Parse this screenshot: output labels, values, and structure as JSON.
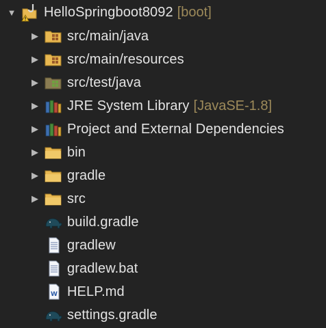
{
  "project": {
    "name": "HelloSpringboot8092",
    "decoration": "[boot]",
    "expanded": true
  },
  "children": [
    {
      "label": "src/main/java",
      "decoration": "",
      "icon": "package-folder-icon",
      "expandable": true
    },
    {
      "label": "src/main/resources",
      "decoration": "",
      "icon": "package-folder-icon",
      "expandable": true
    },
    {
      "label": "src/test/java",
      "decoration": "",
      "icon": "test-package-folder-icon",
      "expandable": true
    },
    {
      "label": "JRE System Library",
      "decoration": "[JavaSE-1.8]",
      "icon": "library-icon",
      "expandable": true
    },
    {
      "label": "Project and External Dependencies",
      "decoration": "",
      "icon": "library-icon",
      "expandable": true
    },
    {
      "label": "bin",
      "decoration": "",
      "icon": "folder-icon",
      "expandable": true
    },
    {
      "label": "gradle",
      "decoration": "",
      "icon": "folder-icon",
      "expandable": true
    },
    {
      "label": "src",
      "decoration": "",
      "icon": "folder-icon",
      "expandable": true
    },
    {
      "label": "build.gradle",
      "decoration": "",
      "icon": "gradle-elephant-icon",
      "expandable": false
    },
    {
      "label": "gradlew",
      "decoration": "",
      "icon": "text-file-icon",
      "expandable": false
    },
    {
      "label": "gradlew.bat",
      "decoration": "",
      "icon": "text-file-icon",
      "expandable": false
    },
    {
      "label": "HELP.md",
      "decoration": "",
      "icon": "word-document-icon",
      "expandable": false
    },
    {
      "label": "settings.gradle",
      "decoration": "",
      "icon": "gradle-elephant-icon",
      "expandable": false
    }
  ],
  "colors": {
    "background": "#232323",
    "text": "#e3e3e3",
    "decoration": "#9d8a5a",
    "folder": "#e8b851",
    "library": "#5a7fb0",
    "gradle": "#1f4a5a"
  }
}
